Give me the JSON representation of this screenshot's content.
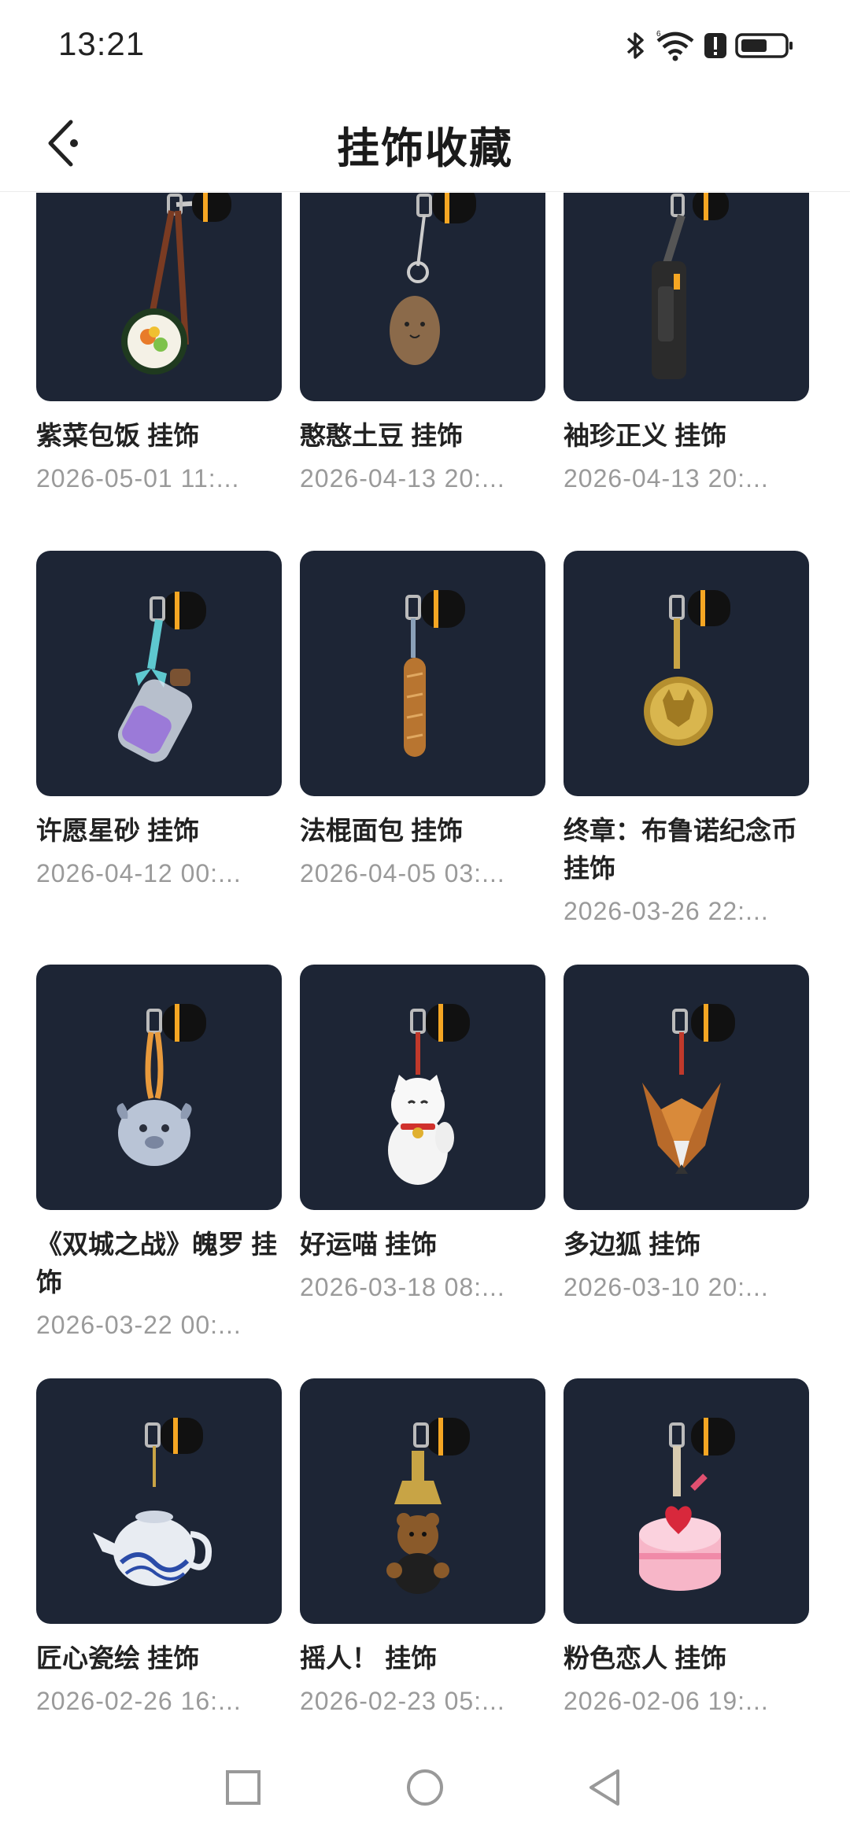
{
  "status_bar": {
    "time": "13:21"
  },
  "header": {
    "title": "挂饰收藏"
  },
  "items": [
    {
      "name": " 紫菜包饭 挂饰",
      "date": "2026-05-01 11:...",
      "icon": "sushi-roll-charm-icon"
    },
    {
      "name": "憨憨土豆 挂饰",
      "date": "2026-04-13 20:...",
      "icon": "potato-charm-icon"
    },
    {
      "name": " 袖珍正义 挂饰",
      "date": "2026-04-13 20:...",
      "icon": "mini-gun-charm-icon"
    },
    {
      "name": "许愿星砂 挂饰",
      "date": "2026-04-12 00:...",
      "icon": "star-sand-bottle-charm-icon"
    },
    {
      "name": "法棍面包 挂饰",
      "date": "2026-04-05 03:...",
      "icon": "baguette-charm-icon"
    },
    {
      "name": "终章：布鲁诺纪念币 挂饰",
      "date": "2026-03-26 22:...",
      "icon": "bruno-coin-charm-icon"
    },
    {
      "name": "《双城之战》魄罗 挂饰",
      "date": "2026-03-22 00:...",
      "icon": "poro-charm-icon"
    },
    {
      "name": "好运喵 挂饰",
      "date": "2026-03-18 08:...",
      "icon": "lucky-cat-charm-icon"
    },
    {
      "name": "多边狐 挂饰",
      "date": "2026-03-10 20:...",
      "icon": "poly-fox-charm-icon"
    },
    {
      "name": "匠心瓷绘 挂饰",
      "date": "2026-02-26 16:...",
      "icon": "porcelain-teapot-charm-icon"
    },
    {
      "name": "摇人！ 挂饰",
      "date": "2026-02-23 05:...",
      "icon": "bell-bear-charm-icon"
    },
    {
      "name": "粉色恋人 挂饰",
      "date": "2026-02-06 19:...",
      "icon": "heart-cake-charm-icon"
    }
  ],
  "colors": {
    "thumb_bg": "#1d2535",
    "hook_orange": "#f5a623",
    "date_gray": "#9a9a9a"
  }
}
